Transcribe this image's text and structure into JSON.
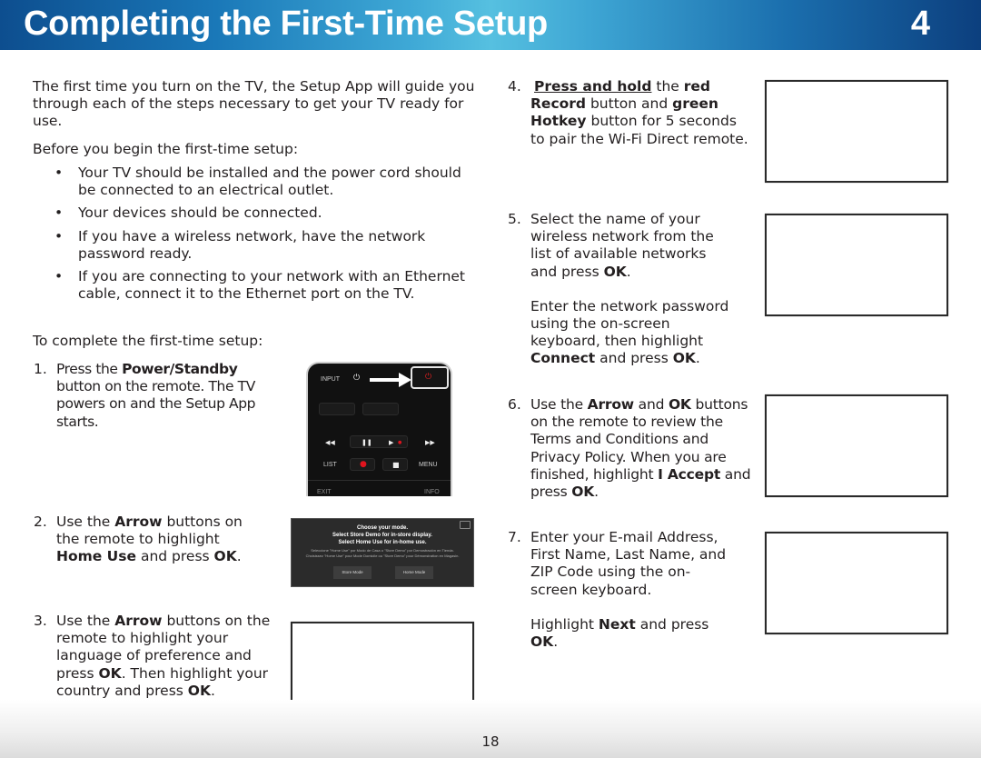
{
  "header": {
    "title": "Completing the First-Time Setup",
    "chapter": "4"
  },
  "intro": {
    "paragraph": "The first time you turn on the TV, the Setup App will guide you through each of the steps necessary to get your TV ready for use.",
    "before_heading": "Before you begin the first-time setup:",
    "bullets": [
      "Your TV should be installed and the power cord should be connected to an electrical outlet.",
      "Your devices should be connected.",
      "If you have a wireless network, have the network password ready.",
      "If you are connecting to your network with an Ethernet cable, connect it to the Ethernet port on the TV."
    ],
    "bullet_glyph": "•",
    "complete_heading": "To complete the first-time setup:"
  },
  "steps": {
    "s1": {
      "num": "1.",
      "a": "Press the ",
      "b1": "Power/Standby",
      "c": " button on the remote. The TV powers on and the Setup App starts."
    },
    "s2": {
      "num": "2.",
      "a": "Use the ",
      "b1": "Arrow",
      "c": " buttons on the remote to highlight ",
      "b2": "Home Use",
      "d": " and press ",
      "b3": "OK",
      "e": "."
    },
    "s3": {
      "num": "3.",
      "a": "Use the ",
      "b1": "Arrow",
      "c": " buttons on the remote to highlight your language of preference and press ",
      "b2": "OK",
      "d": ". Then highlight your country and press ",
      "b3": "OK",
      "e": "."
    },
    "s4": {
      "num": "4.",
      "u1": "Press and hold",
      "a": " the ",
      "b1": "red Record",
      "c": " button and ",
      "b2": "green Hotkey",
      "d": " button for 5 seconds to pair the Wi-Fi Direct remote."
    },
    "s5": {
      "num": "5.",
      "a": "Select the name of your wireless network from the list of available networks and press ",
      "b1": "OK",
      "c": ".",
      "p2a": "Enter the network password using the on-screen keyboard, then highlight ",
      "p2b": "Connect",
      "p2c": " and press ",
      "p2d": "OK",
      "p2e": "."
    },
    "s6": {
      "num": "6.",
      "a": "Use the ",
      "b1": "Arrow",
      "c": " and ",
      "b2": "OK",
      "d": " buttons on the remote to review the Terms and Conditions and Privacy Policy. When you are finished, highlight ",
      "b3": "I Accept",
      "e": " and press ",
      "b4": "OK",
      "f": "."
    },
    "s7": {
      "num": "7.",
      "a": "Enter your E-mail Address, First Name, Last Name, and ZIP Code using the on-screen keyboard.",
      "p2a": "Highlight ",
      "p2b": "Next",
      "p2c": " and press ",
      "p2d": "OK",
      "p2e": "."
    }
  },
  "remote": {
    "labels": {
      "input": "INPUT",
      "list": "LIST",
      "menu": "MENU",
      "exit": "EXIT",
      "info": "INFO"
    },
    "icons": {
      "power": "⏻",
      "rewind": "◀◀",
      "pause": "❚❚",
      "play": "▶",
      "ffwd": "▶▶",
      "record": "●",
      "stop": "■"
    },
    "colors": {
      "power_red": "#e02020",
      "record_red": "#e0141e"
    }
  },
  "mode_screen": {
    "title": "Choose your mode.",
    "line2": "Select Store Demo for in-store display.",
    "line3": "Select Home Use for in-home use.",
    "spanish": "Seleccione \"Home Use\" por Modo de Casa o \"Store Demo\" por Demostración en Tienda.",
    "french": "Choisissez \"Home Use\" pour Mode Domicile ou \"Store Demo\" pour Démonstration en Magasin.",
    "btn_store": "Store Mode",
    "btn_home": "Home Mode"
  },
  "footer": {
    "page_number": "18"
  }
}
